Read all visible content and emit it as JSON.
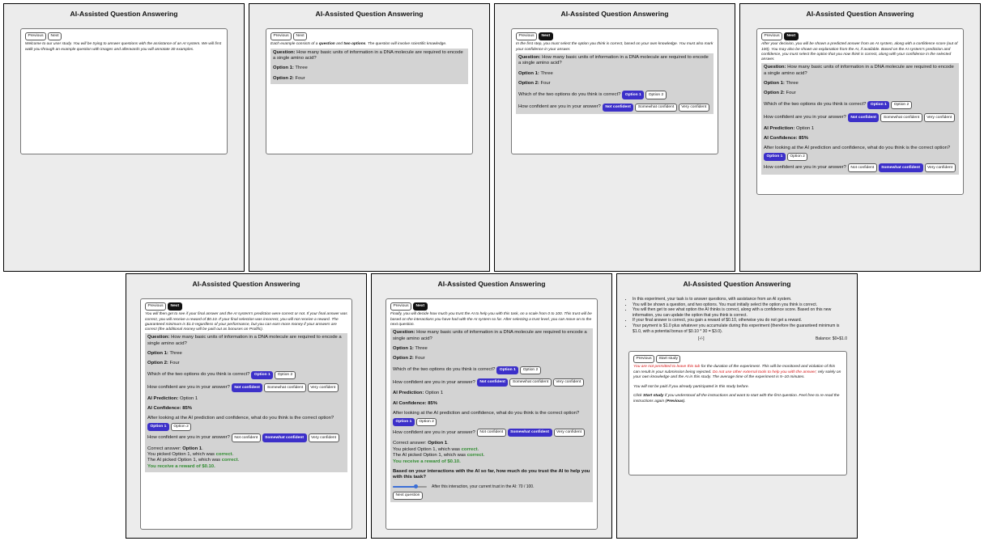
{
  "app_title": "AI-Assisted Question Answering",
  "nav": {
    "previous": "Previous",
    "next": "Next",
    "start": "Start study"
  },
  "labels": {
    "question": "Question:",
    "option1": "Option 1:",
    "option2": "Option 2:",
    "which_correct": "Which of the two options do you think is correct?",
    "how_confident": "How confident are you in your answer?",
    "ai_prediction": "AI Prediction:",
    "ai_confidence": "AI Confidence: 85%",
    "after_looking": "After looking at the AI prediction and confidence, what do you think is the correct option?",
    "correct_answer": "Correct answer:",
    "trust_question": "Based on your interactions with the AI so far, how much do you trust the AI to help you with this task?",
    "trust_readout": "After this interaction, your current trust in the AI: 70 / 100."
  },
  "buttons": {
    "opt1": "Option 1",
    "opt2": "Option 2",
    "not_conf": "Not confident",
    "some_conf": "Somewhat confident",
    "very_conf": "Very confident",
    "next_question": "Next question"
  },
  "question": {
    "text": "How many basic units of information in a DNA molecule are required to encode a single amino acid?",
    "option1": "Three",
    "option2": "Four",
    "ai_prediction": "Option 1",
    "correct_answer": "Option 1"
  },
  "feedback": {
    "picked_prefix": "You picked Option 1, which was ",
    "ai_prefix": "The AI picked Option 1, which was ",
    "correct_word": "correct",
    "reward": "You receive a reward of $0.10."
  },
  "trust": {
    "value": 70,
    "max": 100
  },
  "panels": {
    "p1": {
      "intro": "Welcome to our user study. You will be trying to answer questions with the assistance of an AI system. We will first walk you through an example question with images and afterwards you will annotate 30 examples."
    },
    "p2": {
      "pre": "Each example consists of a ",
      "b1": "question",
      "mid": " and ",
      "b2": "two options",
      "post": ". The question will involve scientific knowledge."
    },
    "p3": {
      "intro": "In the first step, you must select the option you think is correct, based on your own knowledge. You must also mark your confidence in your answer."
    },
    "p4": {
      "intro": "After your decision, you will be shown a predicted answer from an AI system, along with a confidence score (out of 100). You may also be shown an explanation from the AI, if available. Based on the AI system's prediction and confidence, you must select the option that you now think is correct, along with your confidence in the selected answer."
    },
    "p5": {
      "intro": "You will then get to see if your final answer and the AI system's prediction were correct or not. If your final answer was correct, you will receive a reward of $0.10. If your final selection was incorrect, you will not receive a reward. The guaranteed minimum is $1.0 regardless of your performance, but you can earn more money if your answers are correct (the additional money will be paid out as bonuses on Prolific)."
    },
    "p6": {
      "intro": "Finally, you will decide how much you trust the AI to help you with this task, on a scale from 0 to 100. This trust will be based on the interactions you have had with the AI system so far. After selecting a trust level, you can move on to the next question."
    },
    "p7": {
      "bullets": [
        "In this experiment, your task is to answer questions, with assistance from an AI system.",
        "You will be shown a question, and two options. You must initially select the option you think is correct.",
        "You will then get to see what option the AI thinks is correct, along with a confidence score. Based on this new information, you can update the option that you think is correct.",
        "If your final answer is correct, you gain a reward of $0.10, otherwise you do not get a reward.",
        "Your payment is $1.0 plus whatever you accumulate during this experiment (therefore the guaranteed minimum is $1.0, with a potential bonus of $0.10 * 30 = $3.0)."
      ],
      "toggle": "[-/-]",
      "balance": "Balance: $0+$1.0",
      "warn1": "You are not permitted to leave this tab",
      "warn2": " for the duration of the experiment. This will be monitored and violation of this can result in your submission being rejected. ",
      "warn3": "Do not use other external tools to help you with the answer;",
      "warn4": " rely solely on your own knowledge and the AI in this study. The average time of the experiment is 5–10 minutes.",
      "not_paid": "You will not be paid if you already participated in this study before.",
      "click_pre": "Click ",
      "click_b": "Start study",
      "click_mid": " if you understood all the instructions and want to start with the first question. Feel free to re-read the instructions again (",
      "click_b2": "Previous",
      "click_post": ")."
    }
  },
  "colors": {
    "selected": "#3c30c9",
    "dark_button": "#111111",
    "correct_text": "#2e8b2e",
    "warning_text": "#d41515"
  }
}
